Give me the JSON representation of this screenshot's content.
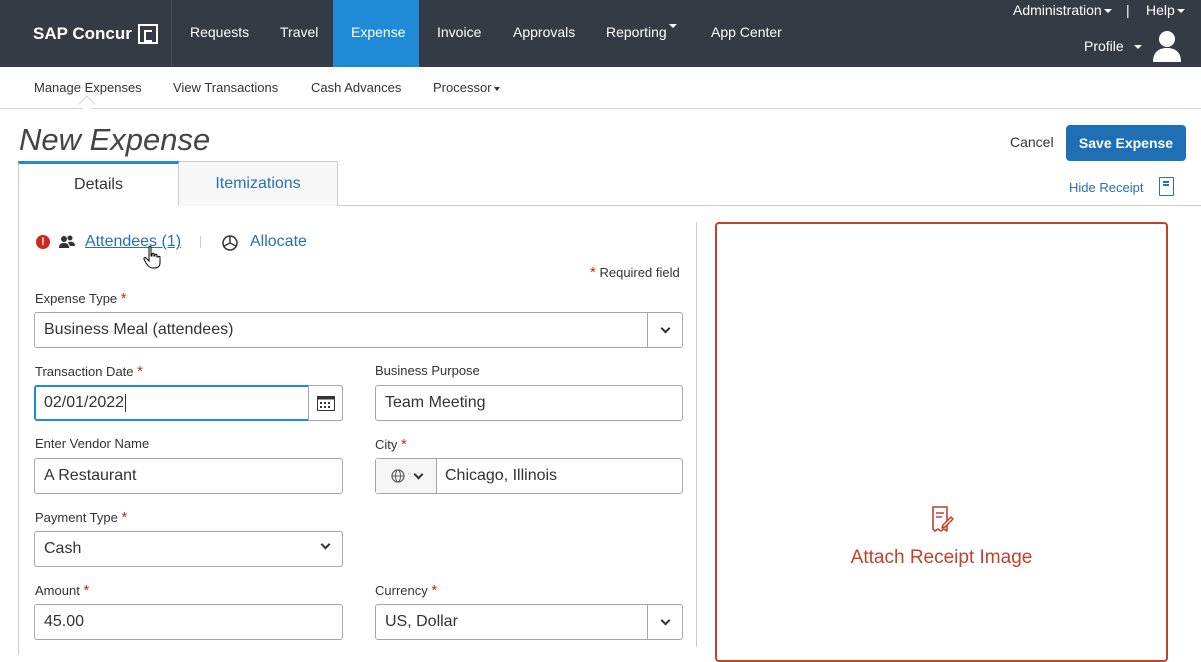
{
  "brand": {
    "name": "SAP Concur"
  },
  "topnav": {
    "items": [
      "Requests",
      "Travel",
      "Expense",
      "Invoice",
      "Approvals",
      "Reporting",
      "App Center"
    ],
    "active": "Expense",
    "administration": "Administration",
    "help": "Help",
    "separator": "|",
    "profile": "Profile"
  },
  "subnav": {
    "items": [
      "Manage Expenses",
      "View Transactions",
      "Cash Advances",
      "Processor"
    ]
  },
  "page": {
    "title": "New Expense",
    "cancel_label": "Cancel",
    "save_label": "Save Expense"
  },
  "tabs": [
    "Details",
    "Itemizations"
  ],
  "hide_receipt": "Hide Receipt",
  "links": {
    "attendees": "Attendees (1)",
    "allocate": "Allocate",
    "required_note": "Required field",
    "required_star": "*"
  },
  "form": {
    "expense_type": {
      "label": "Expense Type",
      "value": "Business Meal (attendees)"
    },
    "transaction_date": {
      "label": "Transaction Date",
      "value": "02/01/2022"
    },
    "business_purpose": {
      "label": "Business Purpose",
      "value": "Team Meeting"
    },
    "vendor": {
      "label": "Enter Vendor Name",
      "value": "A Restaurant"
    },
    "city": {
      "label": "City",
      "value": "Chicago, Illinois"
    },
    "payment_type": {
      "label": "Payment Type",
      "value": "Cash"
    },
    "amount": {
      "label": "Amount",
      "value": "45.00"
    },
    "currency": {
      "label": "Currency",
      "value": "US, Dollar"
    }
  },
  "receipt": {
    "attach_label": "Attach Receipt Image"
  },
  "colors": {
    "nav_bg": "#353b45",
    "active_tab": "#1f8ad6",
    "primary_button": "#1f6fb4",
    "link": "#2a6eb4",
    "required": "#d0271d",
    "receipt_accent": "#c2412a"
  }
}
